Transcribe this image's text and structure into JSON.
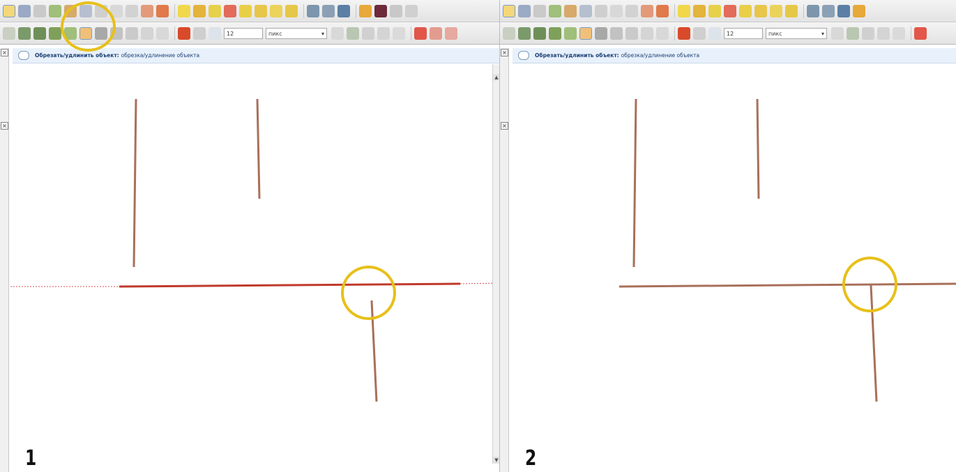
{
  "panels": [
    {
      "step": "1",
      "message": {
        "title": "Обрезать/удлинить объект:",
        "text": "обрезка/удлинение объекта"
      },
      "toolbar": {
        "spin_value": "12",
        "unit": "пикс"
      }
    },
    {
      "step": "2",
      "message": {
        "title": "Обрезать/удлинить объект:",
        "text": "обрезка/удлинение объекта"
      },
      "toolbar": {
        "spin_value": "12",
        "unit": "пикс"
      }
    }
  ],
  "colors": {
    "feature_line": "#a8705a",
    "selected_line": "#c0392b",
    "highlight": "#e7c01a",
    "message_bar": "#e8f1fb"
  },
  "icons": {
    "close": "×",
    "scroll_up": "▲",
    "scroll_down": "▼"
  }
}
